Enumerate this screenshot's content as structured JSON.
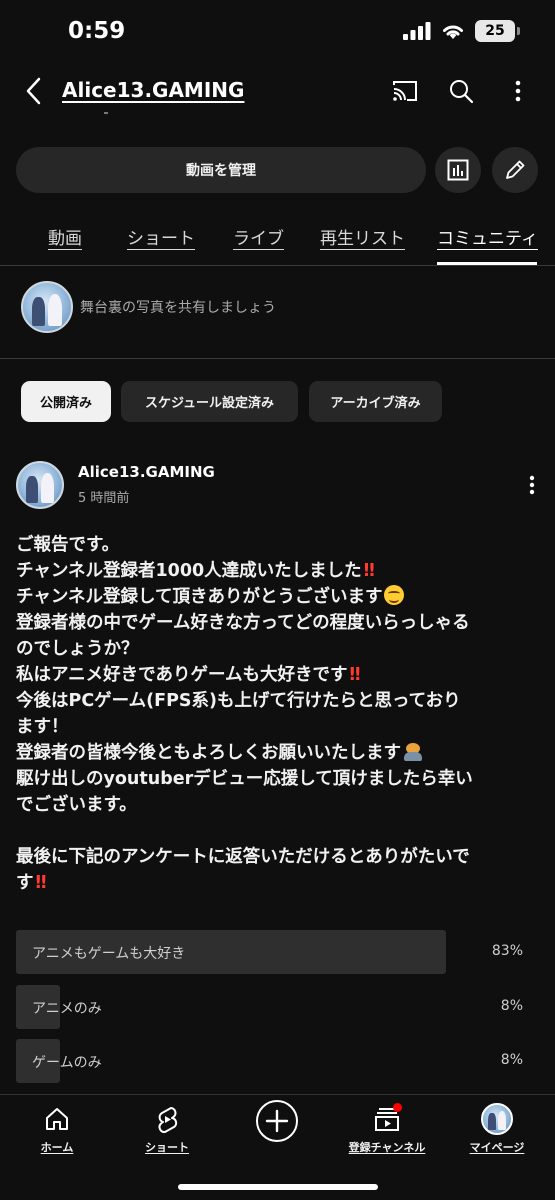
{
  "status_bar": {
    "time": "0:59",
    "battery": "25"
  },
  "header": {
    "channel_title": "Alice13.GAMING"
  },
  "manage_button": {
    "label": "動画を管理"
  },
  "tabs": [
    {
      "label": "動画"
    },
    {
      "label": "ショート"
    },
    {
      "label": "ライブ"
    },
    {
      "label": "再生リスト"
    },
    {
      "label": "コミュニティ",
      "active": true
    }
  ],
  "share": {
    "prompt": "舞台裏の写真を共有しましょう"
  },
  "filters": [
    {
      "label": "公開済み",
      "active": true
    },
    {
      "label": "スケジュール設定済み"
    },
    {
      "label": "アーカイブ済み"
    }
  ],
  "post": {
    "author": "Alice13.GAMING",
    "time": "5 時間前",
    "lines": [
      "ご報告です。",
      "チャンネル登録者1000人達成いたしました",
      "チャンネル登録して頂きありがとうございます",
      "登録者様の中でゲーム好きな方ってどの程度いらっしゃる",
      "のでしょうか？",
      "私はアニメ好きでありゲームも大好きです",
      "今後はPCゲーム(FPS系)も上げて行けたらと思っており",
      "ます！",
      "登録者の皆様今後ともよろしくお願いいたします",
      "駆け出しのyoutuberデビュー応援して頂けましたら幸い",
      "でございます。",
      "",
      "最後に下記のアンケートに返答いただけるとありがたいで",
      "す"
    ],
    "emoji": {
      "double_exclamation": "‼",
      "smile": "smiling-face-emoji",
      "bow": "bowing-person-emoji"
    },
    "poll": [
      {
        "label": "アニメもゲームも大好き",
        "percent": "83%",
        "value": 0.83
      },
      {
        "label": "アニメのみ",
        "percent": "8%",
        "value": 0.08
      },
      {
        "label": "ゲームのみ",
        "percent": "8%",
        "value": 0.08
      }
    ]
  },
  "bottom_nav": [
    {
      "label": "ホーム",
      "icon": "home-icon"
    },
    {
      "label": "ショート",
      "icon": "shorts-icon"
    },
    {
      "label": "",
      "icon": "create-icon"
    },
    {
      "label": "登録チャンネル",
      "icon": "subscriptions-icon"
    },
    {
      "label": "マイページ",
      "icon": "profile-avatar"
    }
  ],
  "colors": {
    "background": "#0f0f0f",
    "chip": "#272727",
    "accent_red": "#ff0000"
  }
}
